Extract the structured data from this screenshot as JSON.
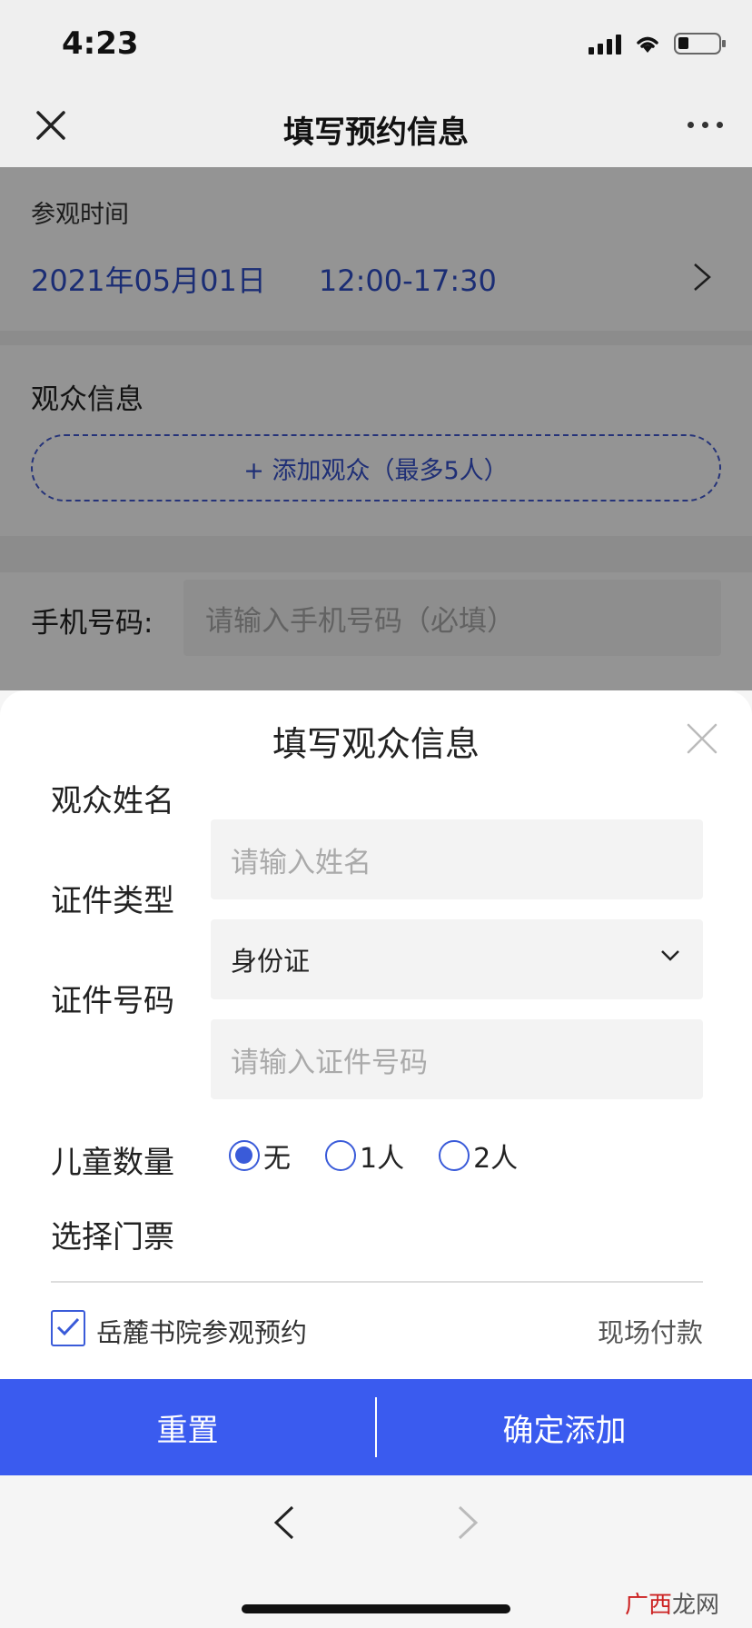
{
  "status_bar": {
    "time": "4:23"
  },
  "nav": {
    "title": "填写预约信息"
  },
  "visit": {
    "label": "参观时间",
    "date": "2021年05月01日",
    "time_slot": "12:00-17:30"
  },
  "audience": {
    "label": "观众信息",
    "add_button": "+ 添加观众（最多5人）"
  },
  "phone": {
    "label": "手机号码:",
    "placeholder": "请输入手机号码（必填）"
  },
  "sheet": {
    "title": "填写观众信息",
    "name_label": "观众姓名",
    "name_placeholder": "请输入姓名",
    "id_type_label": "证件类型",
    "id_type_value": "身份证",
    "id_number_label": "证件号码",
    "id_number_placeholder": "请输入证件号码",
    "children_label": "儿童数量",
    "children_options": [
      "无",
      "1人",
      "2人"
    ],
    "children_selected": "无",
    "ticket_label": "选择门票",
    "ticket_name": "岳麓书院参观预约",
    "ticket_checked": true,
    "ticket_payment": "现场付款"
  },
  "actions": {
    "reset": "重置",
    "confirm": "确定添加"
  },
  "watermark": {
    "part1": "广西",
    "part2": "龙网"
  },
  "colors": {
    "accent": "#3a5bef",
    "link_blue": "#2f4ec9"
  }
}
